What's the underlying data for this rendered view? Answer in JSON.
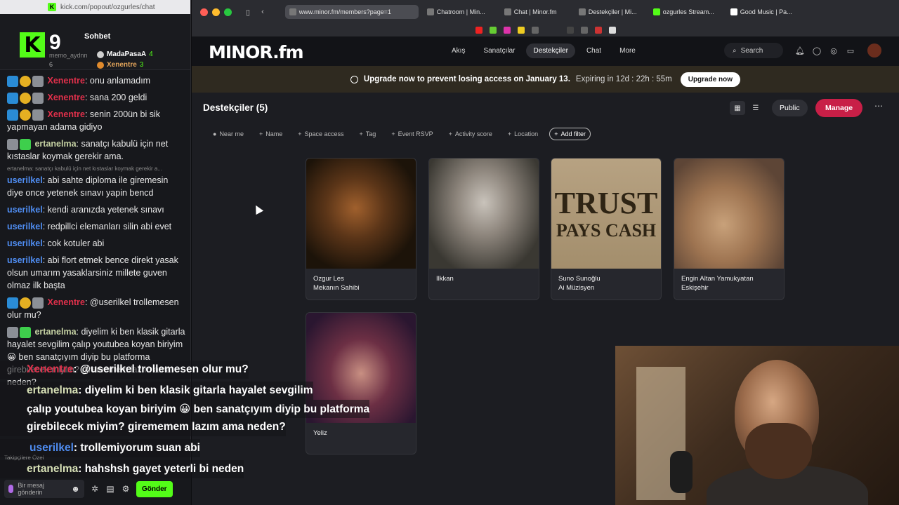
{
  "chat": {
    "url": "kick.com/popout/ozgurles/chat",
    "title": "Sohbet",
    "viewer_count": "9",
    "top_gifter_name": "memo_aydnn",
    "top_gifter_count": "6",
    "gifters": [
      {
        "name": "MadaPasaA",
        "count": "4"
      },
      {
        "name": "Xenentre",
        "count": "3"
      }
    ],
    "messages": [
      {
        "user": "Xenentre",
        "text": ": onu anlamadım"
      },
      {
        "user": "Xenentre",
        "text": ": sana 200 geldi"
      },
      {
        "user": "Xenentre",
        "text": ": senin 200ün bi sik yapmayan adama gidiyo"
      },
      {
        "user": "ertanelma",
        "text": ": sanatçı kabulü için net kıstaslar koymak gerekir ama."
      },
      {
        "reply": "ertanelma: sanatçı kabulü için net kıstaslar koymak gerekir a...",
        "user": "userilkel",
        "text": ": abi sahte diploma ile giremesin diye once yetenek sınavı yapin bencd"
      },
      {
        "user": "userilkel",
        "text": ": kendi aranızda yetenek sınavı"
      },
      {
        "user": "userilkel",
        "text": ": redpillci elemanları silin abi evet"
      },
      {
        "user": "userilkel",
        "text": ": cok kotuler abi"
      },
      {
        "user": "userilkel",
        "text": ": abi flort etmek bence direkt yasak olsun umarım yasaklarsiniz millete guven olmaz ilk başta"
      },
      {
        "user": "Xenentre",
        "text": ": @userilkel trollemesen olur mu?"
      },
      {
        "user": "ertanelma",
        "text": ": diyelim ki ben klasik gitarla hayalet sevgilim çalıp youtubea koyan biriyim 😀 ben sanatçıyım diyip bu platforma girebilecek miyim? girememem lazım ama neden?"
      }
    ],
    "follower_only_label": "Takipçilere Özel",
    "input_placeholder": "Bir mesaj gönderin",
    "send_label": "Gönder"
  },
  "browser": {
    "tabs": [
      {
        "label": "www.minor.fm/members?page=1",
        "active": true
      },
      {
        "label": "Chatroom | Min..."
      },
      {
        "label": "Chat | Minor.fm"
      },
      {
        "label": "Destekçiler | Mi..."
      },
      {
        "label": "ozgurles Stream..."
      },
      {
        "label": "Good Music | Pa..."
      }
    ]
  },
  "site": {
    "logo": "MINOR.fm",
    "nav": [
      "Akış",
      "Sanatçılar",
      "Destekçiler",
      "Chat",
      "More"
    ],
    "search_label": "Search",
    "banner_text": "Upgrade now to prevent losing access on January 13.",
    "banner_expiry": "Expiring in 12d : 22h : 55m",
    "upgrade_label": "Upgrade now",
    "page_title": "Destekçiler (5)",
    "public_label": "Public",
    "manage_label": "Manage",
    "filters": [
      "Near me",
      "Name",
      "Space access",
      "Tag",
      "Event RSVP",
      "Activity score",
      "Location"
    ],
    "add_filter_label": "Add filter",
    "members": [
      {
        "name": "Ozgur Les",
        "sub": "Mekanın Sahibi"
      },
      {
        "name": "Ilkkan",
        "sub": ""
      },
      {
        "name": "Suno Sunoğlu",
        "sub": "Ai Müzisyen",
        "photo_text_1": "TRUST",
        "photo_text_2": "PAYS CASH"
      },
      {
        "name": "Engin Altan Yamukyatan",
        "sub": "Eskişehir"
      },
      {
        "name": "Yeliz",
        "sub": ""
      }
    ]
  },
  "overlay": [
    {
      "user": "Xenentre",
      "text": ": @userilkel trollemesen olur mu?"
    },
    {
      "user": "ertanelma",
      "text": ": diyelim ki ben klasik gitarla hayalet sevgilim"
    },
    {
      "user": "",
      "text": "çalıp youtubea koyan biriyim 😀 ben sanatçıyım diyip bu platforma"
    },
    {
      "user": "",
      "text": "girebilecek miyim? girememem lazım ama neden?"
    },
    {
      "user": "userilkel",
      "text": ": trollemiyorum suan abi"
    },
    {
      "user": "ertanelma",
      "text": ": hahshsh gayet yeterli bi neden"
    }
  ],
  "colors": {
    "kick_green": "#53fc18",
    "manage_red": "#c81f47",
    "user_red": "#e0304b",
    "user_blue": "#4f8df2"
  }
}
